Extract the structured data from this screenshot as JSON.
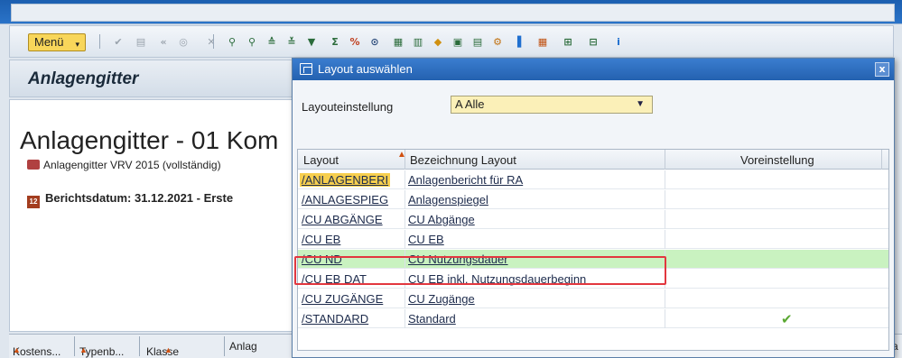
{
  "toolbar": {
    "menu_label": "Menü",
    "icons": [
      "check-icon",
      "save-icon",
      "back-icon",
      "exit-icon",
      "cancel-icon",
      "find-icon",
      "find-next-icon",
      "sort-asc-icon",
      "sort-desc-icon",
      "filter-icon",
      "sum-icon",
      "subtotal-icon",
      "details-icon",
      "export-icon",
      "spreadsheet-icon",
      "layout-icon",
      "view-icon",
      "print-icon",
      "settings-icon",
      "chart-icon",
      "grid-icon",
      "grid-add-icon",
      "grid-remove-icon",
      "info-icon"
    ]
  },
  "page": {
    "header_title": "Anlagengitter",
    "big_title": "Anlagengitter - 01 Kom",
    "subtitle": "Anlagengitter VRV 2015 (vollständig)",
    "report_date": "Berichtsdatum: 31.12.2021 - Erste"
  },
  "column_headers": [
    "Kostens...",
    "Typenb...",
    "Klasse",
    "Anlag",
    "a"
  ],
  "dialog": {
    "title": "Layout auswählen",
    "close_label": "x",
    "setting_label": "Layouteinstellung",
    "setting_value": "A Alle",
    "columns": [
      "Layout",
      "Bezeichnung Layout",
      "Voreinstellung"
    ],
    "rows": [
      {
        "layout": "/ANLAGENBERI",
        "name": "Anlagenbericht für RA",
        "default": false
      },
      {
        "layout": "/ANLAGESPIEG",
        "name": "Anlagenspiegel",
        "default": false
      },
      {
        "layout": "/CU ABGÄNGE",
        "name": "CU Abgänge",
        "default": false
      },
      {
        "layout": "/CU EB",
        "name": "CU EB",
        "default": false
      },
      {
        "layout": "/CU ND",
        "name": "CU Nutzungsdauer",
        "default": false
      },
      {
        "layout": "/CU EB DAT",
        "name": "CU EB inkl. Nutzungsdauerbeginn",
        "default": false
      },
      {
        "layout": "/CU ZUGÄNGE",
        "name": "CU Zugänge",
        "default": false
      },
      {
        "layout": "/STANDARD",
        "name": "Standard",
        "default": true
      }
    ],
    "highlighted_row_index": 4
  },
  "colors": {
    "accent": "#2461b0",
    "highlight_row": "#c9f2c0",
    "highlight_box": "#e2373f",
    "selected_cell": "#f7cf4e",
    "menu_button": "#f8d65a"
  }
}
